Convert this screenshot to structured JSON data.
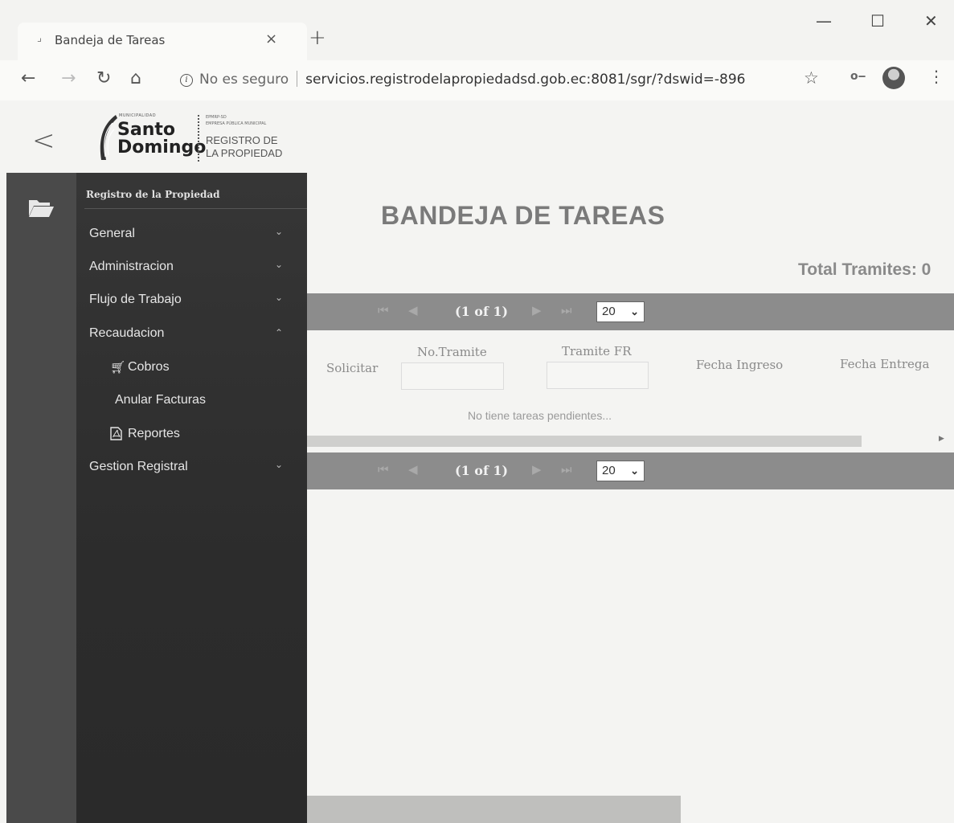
{
  "browser": {
    "tab_title": "Bandeja de Tareas",
    "tab_close": "×",
    "new_tab": "+",
    "window_min": "—",
    "window_max": "☐",
    "window_close": "✕",
    "security_label": "No es seguro",
    "url": "servicios.registrodelapropiedadsd.gob.ec:8081/sgr/?dswid=-896"
  },
  "logo": {
    "small_top": "MUNICIPALIDAD",
    "city_line1": "Santo",
    "city_line2": "Domingo",
    "entity_small1": "EPMRP-SD",
    "entity_small2": "EMPRESA PÚBLICA MUNICIPAL",
    "registry_line1": "REGISTRO DE",
    "registry_line2": "LA PROPIEDAD"
  },
  "sidebar": {
    "title": "Registro de la Propiedad",
    "items": [
      {
        "label": "General",
        "chevron": "⌄"
      },
      {
        "label": "Administracion",
        "chevron": "⌄"
      },
      {
        "label": "Flujo de Trabajo",
        "chevron": "⌄"
      },
      {
        "label": "Recaudacion",
        "chevron": "⌃"
      },
      {
        "label": "Cobros",
        "icon": "cart-icon"
      },
      {
        "label": "Anular Facturas"
      },
      {
        "label": "Reportes",
        "icon": "pdf-icon"
      },
      {
        "label": "Gestion Registral",
        "chevron": "⌄"
      }
    ]
  },
  "main": {
    "title": "BANDEJA DE TAREAS",
    "total_label": "Total Tramites: 0",
    "paginator": {
      "first": "⏮",
      "prev": "◀",
      "current": "(1 of 1)",
      "next": "▶",
      "last": "⏭",
      "rows_per_page": "20",
      "chevron": "⌄"
    },
    "columns": [
      "Solicitar",
      "No.Tramite",
      "Tramite FR",
      "Fecha Ingreso",
      "Fecha Entrega"
    ],
    "empty_message": "No tiene tareas pendientes..."
  },
  "colors": {
    "sidebar_bg": "#2f2f2f",
    "rail_bg": "#4a4a4a",
    "paginator_bg": "#8c8c8c"
  }
}
